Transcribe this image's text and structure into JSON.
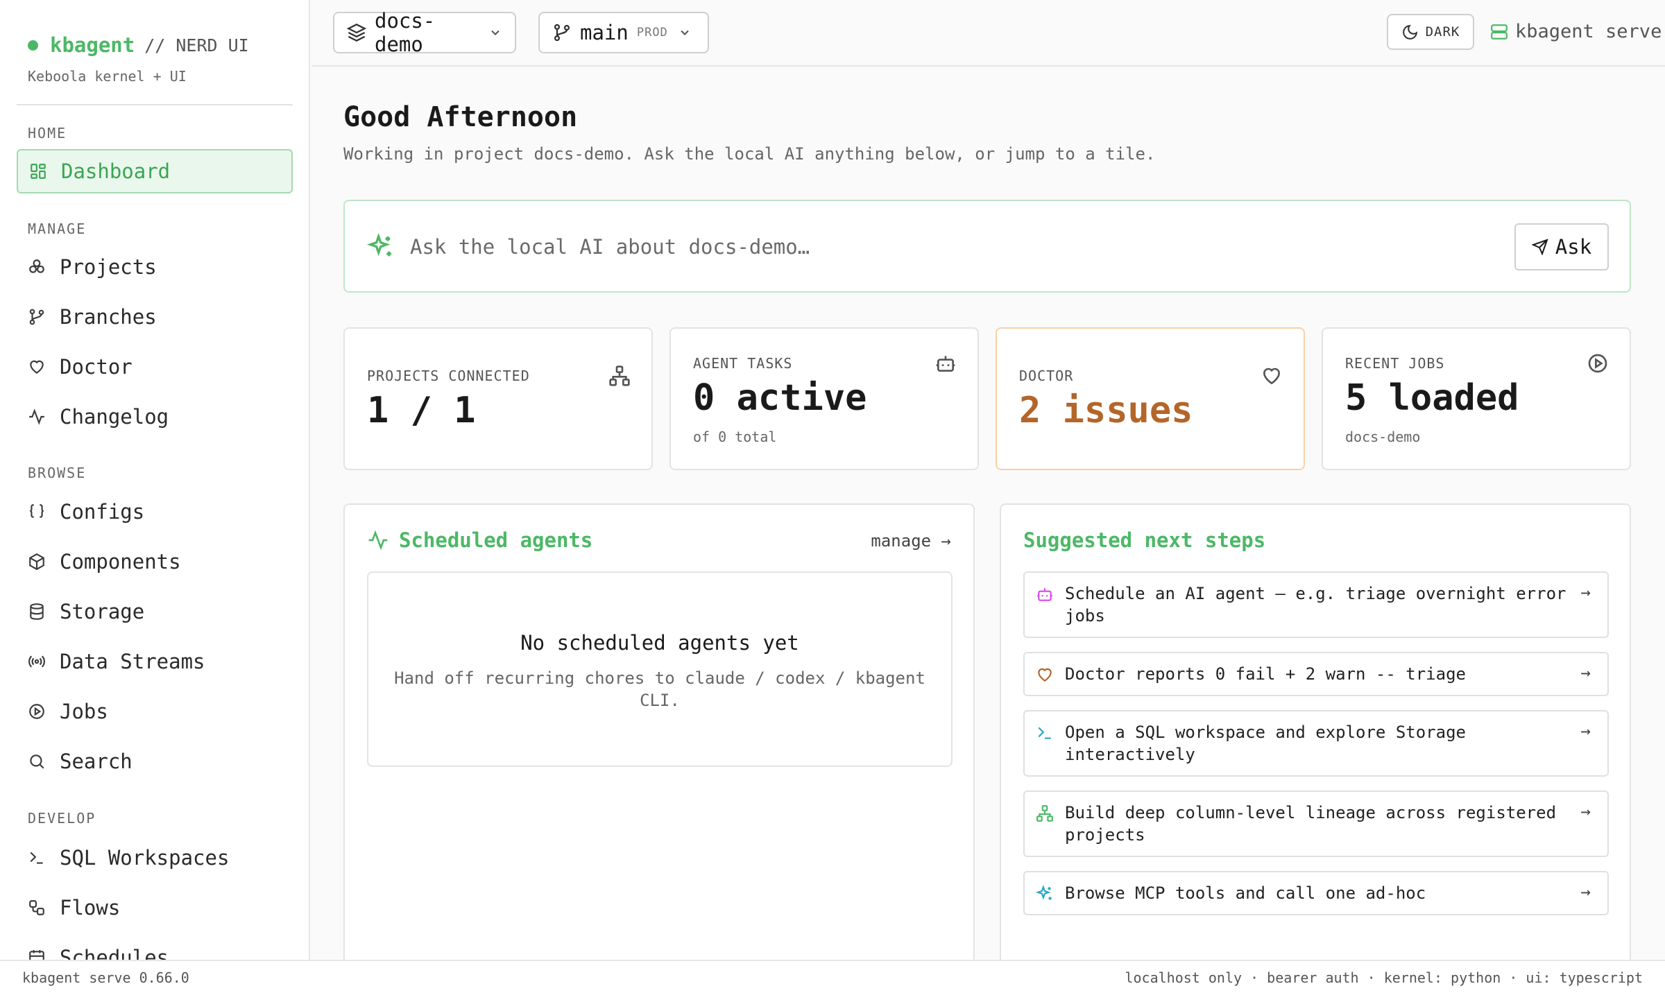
{
  "brand": {
    "name": "kbagent",
    "suffix": "// NERD UI",
    "subtitle": "Keboola kernel + UI"
  },
  "sidebar": {
    "sections": [
      {
        "label": "HOME",
        "items": [
          {
            "label": "Dashboard",
            "icon": "dashboard-icon",
            "active": true
          }
        ]
      },
      {
        "label": "MANAGE",
        "items": [
          {
            "label": "Projects",
            "icon": "projects-icon"
          },
          {
            "label": "Branches",
            "icon": "branch-icon"
          },
          {
            "label": "Doctor",
            "icon": "heart-icon"
          },
          {
            "label": "Changelog",
            "icon": "activity-icon"
          }
        ]
      },
      {
        "label": "BROWSE",
        "items": [
          {
            "label": "Configs",
            "icon": "braces-icon"
          },
          {
            "label": "Components",
            "icon": "package-icon"
          },
          {
            "label": "Storage",
            "icon": "database-icon"
          },
          {
            "label": "Data Streams",
            "icon": "radio-icon"
          },
          {
            "label": "Jobs",
            "icon": "play-circle-icon"
          },
          {
            "label": "Search",
            "icon": "search-icon"
          }
        ]
      },
      {
        "label": "DEVELOP",
        "items": [
          {
            "label": "SQL Workspaces",
            "icon": "terminal-icon"
          },
          {
            "label": "Flows",
            "icon": "workflow-icon"
          },
          {
            "label": "Schedules",
            "icon": "calendar-icon"
          }
        ]
      }
    ]
  },
  "topbar": {
    "project": "docs-demo",
    "branch": "main",
    "branch_badge": "PROD",
    "theme_label": "DARK",
    "serve_label": "kbagent serve"
  },
  "main": {
    "greeting": "Good Afternoon",
    "subtitle": "Working in project docs-demo. Ask the local AI anything below, or jump to a tile.",
    "ask_placeholder": "Ask the local AI about docs-demo…",
    "ask_button": "Ask"
  },
  "stats": [
    {
      "label": "PROJECTS CONNECTED",
      "value": "1 / 1",
      "sub": "",
      "icon": "network-icon"
    },
    {
      "label": "AGENT TASKS",
      "value": "0 active",
      "sub": "of 0 total",
      "icon": "bot-icon"
    },
    {
      "label": "DOCTOR",
      "value": "2 issues",
      "sub": "",
      "icon": "heart-icon"
    },
    {
      "label": "RECENT JOBS",
      "value": "5 loaded",
      "sub": "docs-demo",
      "icon": "play-circle-icon"
    }
  ],
  "scheduled": {
    "title": "Scheduled agents",
    "manage_label": "manage →",
    "empty_title": "No scheduled agents yet",
    "empty_desc": "Hand off recurring chores to claude / codex / kbagent CLI."
  },
  "suggested": {
    "title": "Suggested next steps",
    "steps": [
      {
        "text": "Schedule an AI agent — e.g. triage overnight error jobs",
        "icon": "bot-icon",
        "color": "#d946ef"
      },
      {
        "text": "Doctor reports 0 fail + 2 warn -- triage",
        "icon": "heart-icon",
        "color": "#b4652a"
      },
      {
        "text": "Open a SQL workspace and explore Storage interactively",
        "icon": "terminal-icon",
        "color": "#22a6c7"
      },
      {
        "text": "Build deep column-level lineage across registered projects",
        "icon": "network-icon",
        "color": "#4cb866"
      },
      {
        "text": "Browse MCP tools and call one ad-hoc",
        "icon": "sparkles-icon",
        "color": "#22a6c7"
      }
    ],
    "arrow": "→"
  },
  "statusbar": {
    "left": "kbagent serve 0.66.0",
    "right": "localhost only · bearer auth · kernel: python · ui: typescript"
  },
  "colors": {
    "accent": "#4cb866",
    "warning": "#b4652a",
    "warning_border": "#f7d2a4"
  }
}
